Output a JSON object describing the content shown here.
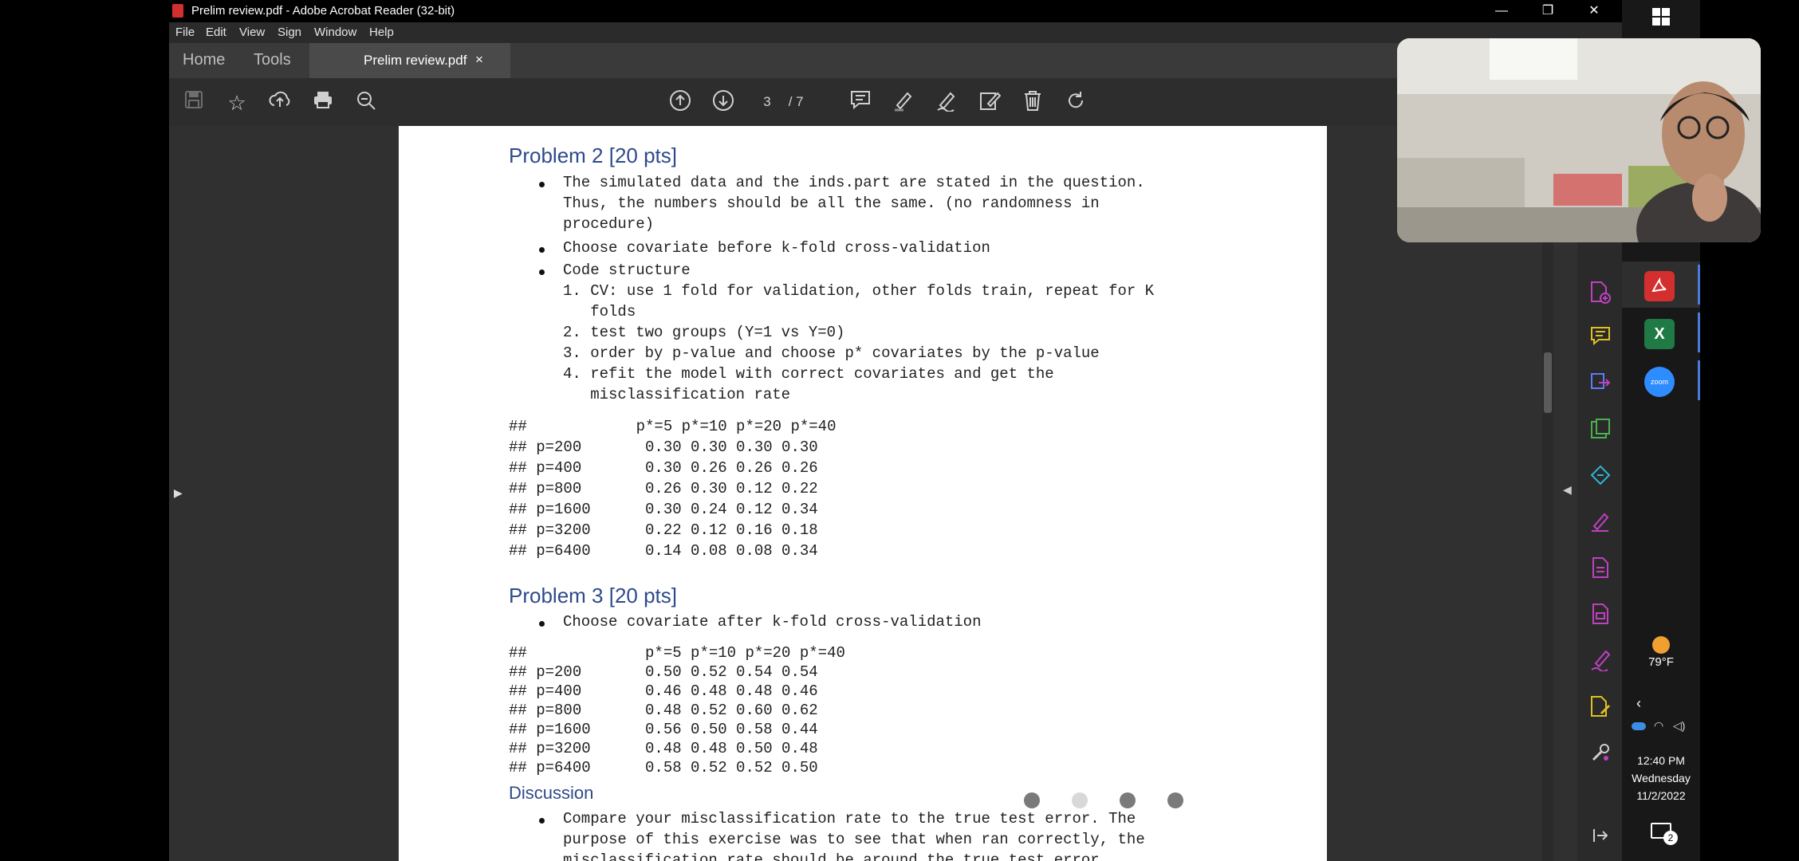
{
  "window": {
    "title": "Prelim review.pdf - Adobe Acrobat Reader (32-bit)",
    "controls": {
      "minimize": "—",
      "restore": "❐",
      "close": "✕"
    }
  },
  "menu": [
    "File",
    "Edit",
    "View",
    "Sign",
    "Window",
    "Help"
  ],
  "tabs": {
    "home": "Home",
    "tools": "Tools",
    "document": "Prelim review.pdf",
    "close": "×"
  },
  "toolbar": {
    "page_current": "3",
    "page_total": "/ 7"
  },
  "document": {
    "problem2_title": "Problem 2 [20 pts]",
    "p2_bullet1_line1": "The simulated data and the inds.part are stated in the question.",
    "p2_bullet1_line2": "Thus, the numbers should be all the same. (no randomness in",
    "p2_bullet1_line3": "procedure)",
    "p2_bullet2": "Choose covariate before k-fold cross-validation",
    "p2_bullet3": "Code structure",
    "p2_step1_line1": "1. CV: use 1 fold for validation, other folds train, repeat for K",
    "p2_step1_line2": "   folds",
    "p2_step2": "2. test two groups (Y=1 vs Y=0)",
    "p2_step3": "3. order by p-value and choose p* covariates by the p-value",
    "p2_step4_line1": "4. refit the model with correct covariates and get the",
    "p2_step4_line2": "   misclassification rate",
    "p2_table": [
      "##            p*=5 p*=10 p*=20 p*=40",
      "## p=200       0.30 0.30 0.30 0.30",
      "## p=400       0.30 0.26 0.26 0.26",
      "## p=800       0.26 0.30 0.12 0.22",
      "## p=1600      0.30 0.24 0.12 0.34",
      "## p=3200      0.22 0.12 0.16 0.18",
      "## p=6400      0.14 0.08 0.08 0.34"
    ],
    "problem3_title": "Problem 3 [20 pts]",
    "p3_bullet1": "Choose covariate after k-fold cross-validation",
    "p3_table": [
      "##             p*=5 p*=10 p*=20 p*=40",
      "## p=200       0.50 0.52 0.54 0.54",
      "## p=400       0.46 0.48 0.48 0.46",
      "## p=800       0.48 0.52 0.60 0.62",
      "## p=1600      0.56 0.50 0.58 0.44",
      "## p=3200      0.48 0.48 0.50 0.48",
      "## p=6400      0.58 0.52 0.52 0.50"
    ],
    "discussion_title": "Discussion",
    "disc_line1": "Compare your misclassification rate to the true test error. The",
    "disc_line2": "purpose of this exercise was to see that when ran correctly, the",
    "disc_line3": "misclassification rate should be around the true test error."
  },
  "taskbar": {
    "weather_temp": "79°F",
    "time": "12:40 PM",
    "day": "Wednesday",
    "date": "11/2/2022",
    "notif_count": "2",
    "zoom_label": "zoom",
    "excel_label": "X"
  },
  "colors": {
    "heading": "#2e4a8a",
    "tool_pink": "#c040c0",
    "acrobat_red": "#d32f2f",
    "excel_green": "#1f7a45",
    "zoom_blue": "#2d8cff"
  }
}
